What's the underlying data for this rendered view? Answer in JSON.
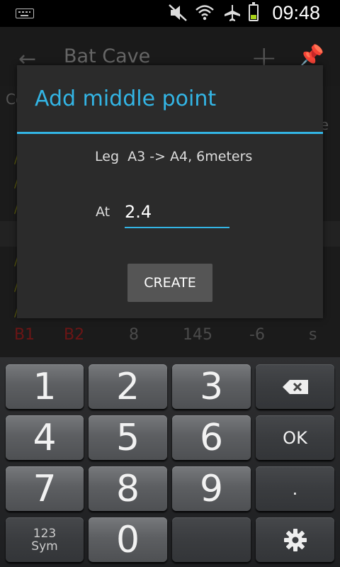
{
  "status": {
    "time": "09:48"
  },
  "appbar": {
    "title": "Bat Cave",
    "back_icon": "arrow-back-icon",
    "add_icon": "plus-icon",
    "pin_icon": "pin-icon"
  },
  "background": {
    "header_left": "Co",
    "header_right": "e",
    "row": {
      "from": "B1",
      "to": "B2",
      "distance": "8",
      "azimuth": "145",
      "inclination": "-6",
      "flag": "s"
    }
  },
  "dialog": {
    "title": "Add middle point",
    "leg_text": "Leg  A3 -> A4, 6meters",
    "at_label": "At",
    "at_value": "2.4",
    "create_label": "CREATE"
  },
  "keyboard": {
    "keys": [
      "1",
      "2",
      "3",
      "4",
      "5",
      "6",
      "7",
      "8",
      "9",
      "0"
    ],
    "ok_label": "OK",
    "dot_label": ".",
    "sym_line1": "123",
    "sym_line2": "Sym",
    "backspace_icon": "backspace-icon",
    "settings_icon": "gear-icon"
  },
  "colors": {
    "accent": "#33b5e5",
    "battery": "#a8d317"
  }
}
